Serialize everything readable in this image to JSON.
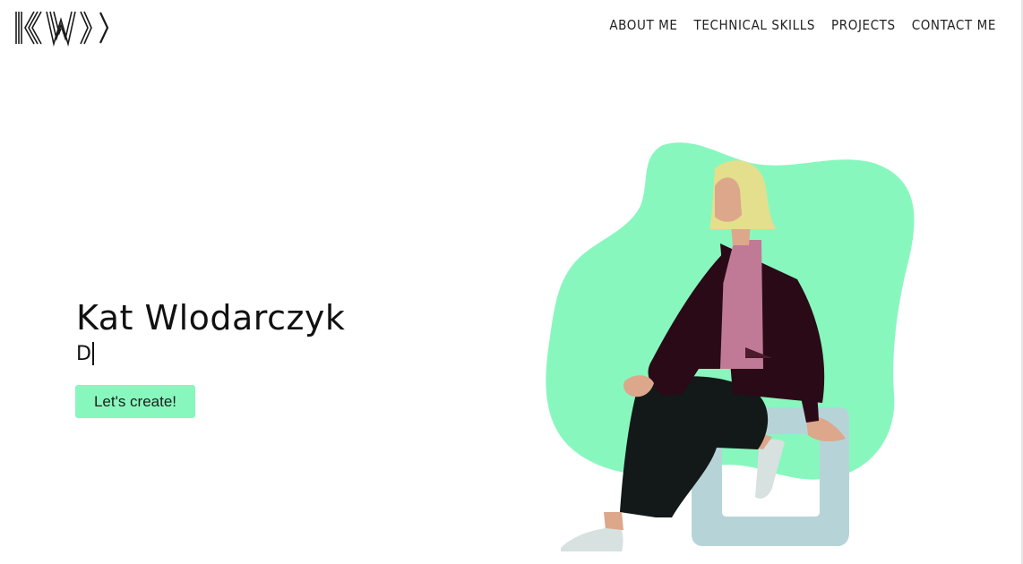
{
  "brand": {
    "logo_label": "KW",
    "accent_color": "#88f7be"
  },
  "nav": {
    "items": [
      {
        "label": "ABOUT ME"
      },
      {
        "label": "TECHNICAL SKILLS"
      },
      {
        "label": "PROJECTS"
      },
      {
        "label": "CONTACT ME"
      }
    ]
  },
  "hero": {
    "name": "Kat Wlodarczyk",
    "typed_text": "D",
    "cta_label": "Let's create!"
  },
  "illustration": {
    "subject": "woman-sitting-on-chair",
    "blob_color": "#88f7be",
    "chair_color": "#b6d4d8"
  }
}
